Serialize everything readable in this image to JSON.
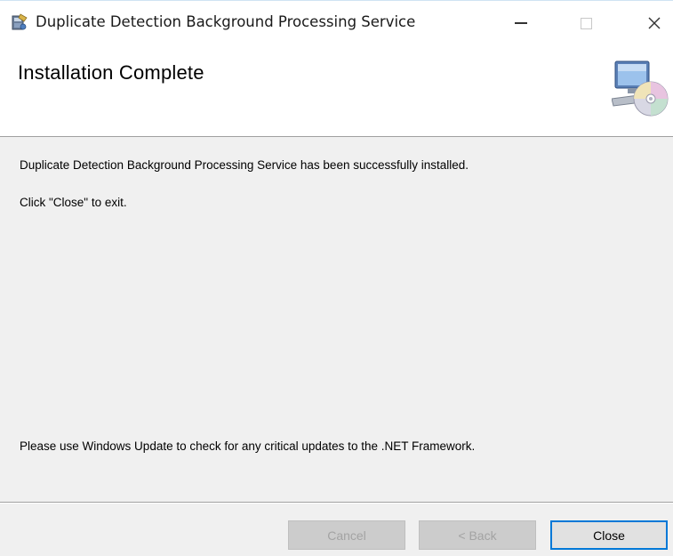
{
  "window": {
    "title": "Duplicate Detection Background Processing Service",
    "controls": {
      "minimize": "—",
      "maximize": "☐",
      "close": "✕"
    }
  },
  "banner": {
    "heading": "Installation Complete"
  },
  "content": {
    "success_message": "Duplicate Detection Background Processing Service has been successfully installed.",
    "exit_instruction": "Click \"Close\" to exit.",
    "update_notice": "Please use Windows Update to check for any critical updates to the .NET Framework."
  },
  "footer": {
    "cancel_label": "Cancel",
    "back_label": "< Back",
    "close_label": "Close"
  },
  "colors": {
    "accent": "#0078d7",
    "panel_background": "#f0f0f0",
    "disabled_text": "#a3a3a3"
  },
  "icons": {
    "app": "installer-package-icon",
    "banner": "computer-cd-icon"
  }
}
